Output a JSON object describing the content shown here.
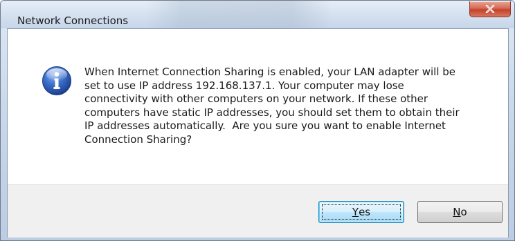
{
  "window": {
    "title": "Network Connections",
    "close_label": "Close"
  },
  "message": {
    "icon": "info-icon",
    "text": "When Internet Connection Sharing is enabled, your LAN adapter will be\nset to use IP address 192.168.137.1. Your computer may lose\nconnectivity with other computers on your network. If these other\ncomputers have static IP addresses, you should set them to obtain their\nIP addresses automatically.  Are you sure you want to enable Internet\nConnection Sharing?"
  },
  "buttons": {
    "yes": {
      "accel": "Y",
      "rest": "es"
    },
    "no": {
      "accel": "N",
      "rest": "o"
    }
  },
  "colors": {
    "info_icon": "#2a5fb5",
    "close_button": "#c4412a",
    "default_button_border": "#3c7fb1"
  }
}
